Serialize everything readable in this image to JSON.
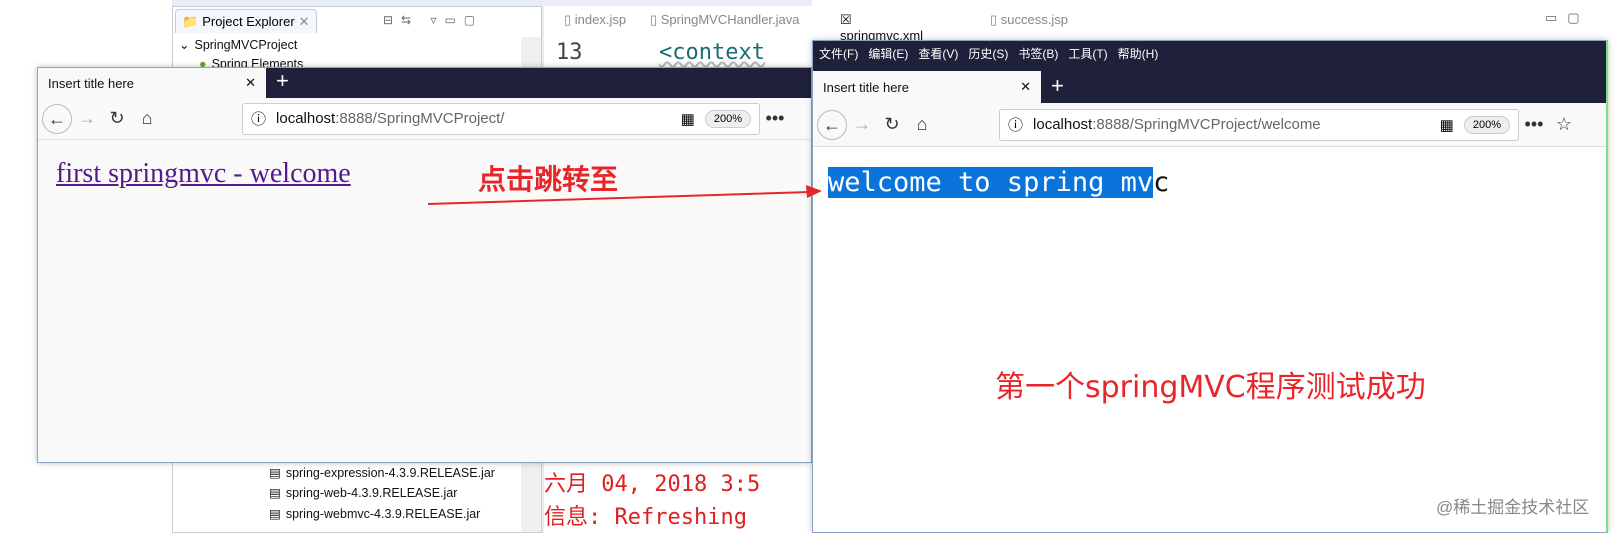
{
  "eclipse": {
    "project_explorer": {
      "title": "Project Explorer",
      "project": "SpringMVCProject",
      "items": [
        "Spring Elements"
      ],
      "jars": [
        "spring-expression-4.3.9.RELEASE.jar",
        "spring-web-4.3.9.RELEASE.jar",
        "spring-webmvc-4.3.9.RELEASE.jar"
      ]
    },
    "editor_tabs": [
      "index.jsp",
      "SpringMVCHandler.java",
      "springmvc.xml",
      "success.jsp"
    ],
    "active_tab": "springmvc.xml",
    "code_line_number": "13",
    "code_line": "<context",
    "console": [
      "六月 04, 2018 3:5",
      "信息: Refreshing"
    ]
  },
  "left_browser": {
    "tab_title": "Insert title here",
    "url_host": "localhost",
    "url_rest": ":8888/SpringMVCProject/",
    "zoom": "200%",
    "link": "first springmvc - welcome"
  },
  "right_browser": {
    "menu": [
      "文件(F)",
      "编辑(E)",
      "查看(V)",
      "历史(S)",
      "书签(B)",
      "工具(T)",
      "帮助(H)"
    ],
    "tab_title": "Insert title here",
    "url_host": "localhost",
    "url_rest": ":8888/SpringMVCProject/welcome",
    "zoom": "200%",
    "content_selected": "welcome to spring mv",
    "content_rest": "c"
  },
  "annotations": {
    "arrow_label": "点击跳转至",
    "success_label": "第一个springMVC程序测试成功",
    "color": "#e8262a"
  },
  "watermark": "@稀土掘金技术社区"
}
